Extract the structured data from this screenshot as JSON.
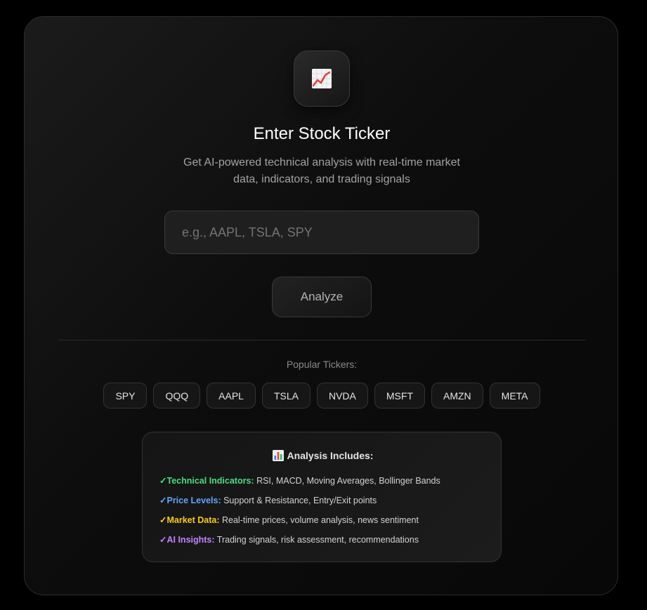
{
  "header": {
    "logo_icon": "chart-increasing-icon",
    "title": "Enter Stock Ticker",
    "subtitle": "Get AI-powered technical analysis with real-time market data, indicators, and trading signals"
  },
  "search": {
    "placeholder": "e.g., AAPL, TSLA, SPY",
    "value": ""
  },
  "analyze_label": "Analyze",
  "popular": {
    "label": "Popular Tickers:",
    "tickers": [
      "SPY",
      "QQQ",
      "AAPL",
      "TSLA",
      "NVDA",
      "MSFT",
      "AMZN",
      "META"
    ]
  },
  "includes": {
    "icon": "bar-chart-icon",
    "title": "Analysis Includes:",
    "check": "✓",
    "items": [
      {
        "label": "Technical Indicators:",
        "text": " RSI, MACD, Moving Averages, Bollinger Bands",
        "color": "#4ade80"
      },
      {
        "label": "Price Levels:",
        "text": " Support & Resistance, Entry/Exit points",
        "color": "#60a5fa"
      },
      {
        "label": "Market Data:",
        "text": " Real-time prices, volume analysis, news sentiment",
        "color": "#facc15"
      },
      {
        "label": "AI Insights:",
        "text": " Trading signals, risk assessment, recommendations",
        "color": "#c084fc"
      }
    ]
  }
}
